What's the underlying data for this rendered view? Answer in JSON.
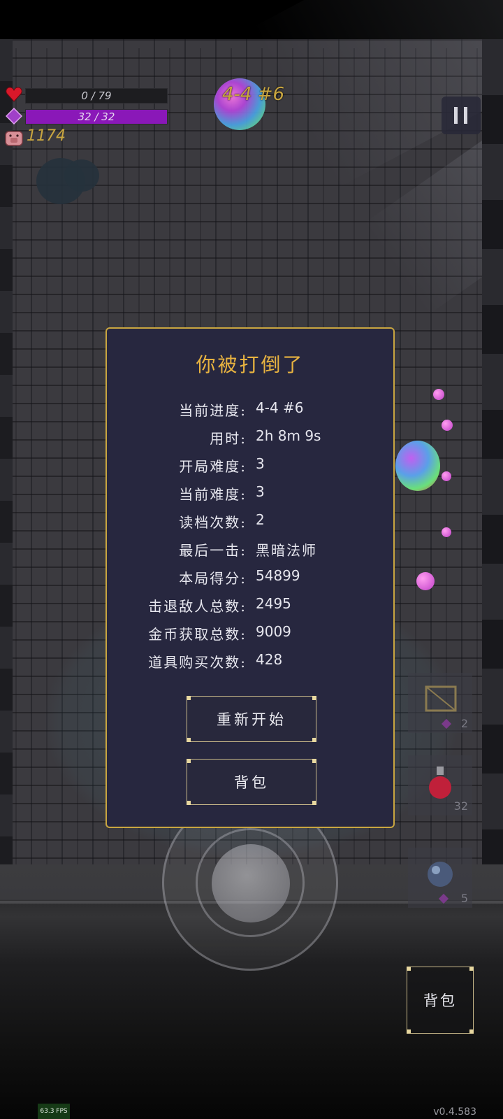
{
  "hud": {
    "hp": {
      "text": "0 / 79",
      "current": 0,
      "max": 79
    },
    "mp": {
      "text": "32 / 32",
      "current": 32,
      "max": 32,
      "fill_fraction": 1.0
    },
    "coins": "1174",
    "stage": "4-4 #6",
    "icons": {
      "hp": "heart-icon",
      "mp": "mana-gem-icon",
      "coins": "pig-icon",
      "pause": "pause-icon"
    }
  },
  "dialog": {
    "title": "你被打倒了",
    "stats": [
      {
        "label": "当前进度:",
        "value": "4-4 #6"
      },
      {
        "label": "用时:",
        "value": "2h 8m 9s"
      },
      {
        "label": "开局难度:",
        "value": "3"
      },
      {
        "label": "当前难度:",
        "value": "3"
      },
      {
        "label": "读档次数:",
        "value": "2"
      },
      {
        "label": "最后一击:",
        "value": "黑暗法师"
      },
      {
        "label": "本局得分:",
        "value": "54899"
      },
      {
        "label": "击退敌人总数:",
        "value": "2495"
      },
      {
        "label": "金币获取总数:",
        "value": "9009"
      },
      {
        "label": "道具购买次数:",
        "value": "428"
      }
    ],
    "restart_label": "重新开始",
    "bag_label": "背包"
  },
  "items": [
    {
      "count": "2",
      "icon": "crate-icon"
    },
    {
      "count": "32",
      "icon": "potion-icon"
    },
    {
      "count": "5",
      "icon": "orb-item-icon"
    }
  ],
  "controls": {
    "bag_label": "背包",
    "joystick": "joystick"
  },
  "footer": {
    "fps": "63.3 FPS",
    "version": "v0.4.583"
  },
  "colors": {
    "accent_gold": "#c9a640",
    "mana_purple": "#8a18b8",
    "dialog_bg": "#27273f"
  }
}
